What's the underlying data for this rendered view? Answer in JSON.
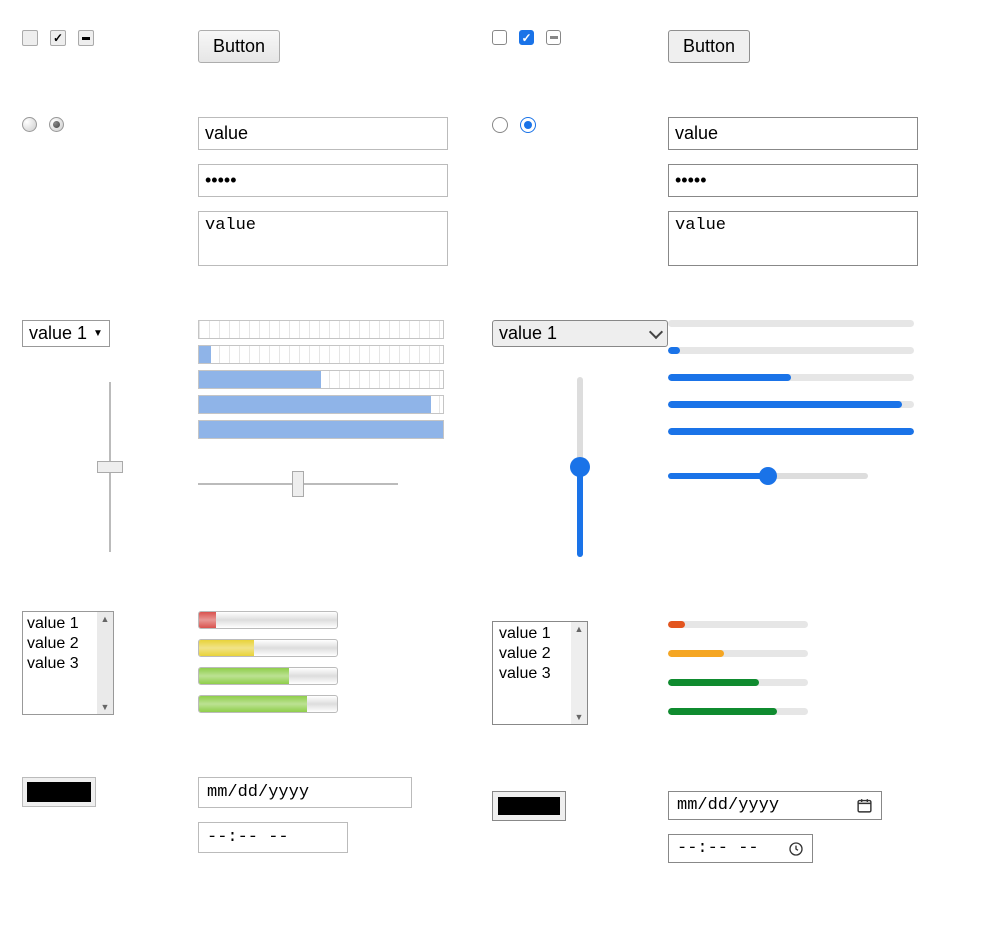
{
  "buttons": {
    "label": "Button"
  },
  "text_inputs": {
    "value": "value",
    "password": "•••••",
    "textarea": "value"
  },
  "select": {
    "selected": "value 1",
    "options": [
      "value 1",
      "value 2",
      "value 3"
    ]
  },
  "progress_values": [
    0,
    5,
    50,
    95,
    100
  ],
  "slider": {
    "vertical_value": 50,
    "horizontal_value": 50
  },
  "listbox": {
    "options": [
      "value 1",
      "value 2",
      "value 3"
    ]
  },
  "meters": [
    {
      "value": 12,
      "color": "#d9534f",
      "modern_color": "#e3551f"
    },
    {
      "value": 40,
      "color": "#e8d23a",
      "modern_color": "#f5a623"
    },
    {
      "value": 65,
      "color": "#8fce4b",
      "modern_color": "#0f8b2f"
    },
    {
      "value": 78,
      "color": "#8fce4b",
      "modern_color": "#0f8b2f"
    }
  ],
  "color_input": {
    "value": "#000000"
  },
  "date_input": {
    "placeholder": "mm/dd/yyyy"
  },
  "time_input": {
    "placeholder": "--:-- --"
  }
}
